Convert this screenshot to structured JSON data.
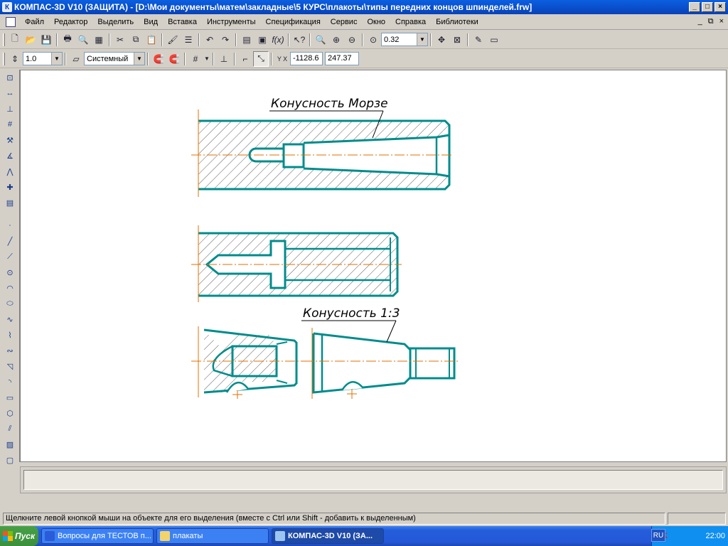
{
  "window": {
    "title": "КОМПАС-3D V10 (ЗАЩИТА) - [D:\\Мои документы\\матем\\закладные\\5 КУРС\\плакоты\\типы передних концов шпинделей.frw]",
    "app_icon": "К",
    "min_label": "_",
    "max_label": "□",
    "close_label": "×"
  },
  "menu": {
    "items": [
      "Файл",
      "Редактор",
      "Выделить",
      "Вид",
      "Вставка",
      "Инструменты",
      "Спецификация",
      "Сервис",
      "Окно",
      "Справка",
      "Библиотеки"
    ],
    "mdi_min": "_",
    "mdi_restore": "⧉",
    "mdi_close": "×"
  },
  "toolbar1": {
    "zoom_value": "0.32"
  },
  "toolbar2": {
    "step_value": "1.0",
    "style_value": "Системный",
    "coord_x": "-1128.6",
    "coord_y": "247.37"
  },
  "drawing": {
    "label_morse": "Конусность Морзе",
    "label_taper": "Конусность 1:3",
    "line_color": "#008c8c",
    "axis_color": "#e07000"
  },
  "status": {
    "message": "Щелкните левой кнопкой мыши на объекте для его выделения (вместе с Ctrl или Shift - добавить к выделенным)"
  },
  "taskbar": {
    "start_label": "Пуск",
    "tasks": [
      {
        "label": "Вопросы для ТЕСТОВ п...",
        "icon": "word-icon"
      },
      {
        "label": "плакаты",
        "icon": "folder-icon"
      },
      {
        "label": "КОМПАС-3D V10 (ЗА...",
        "icon": "kompas-icon"
      }
    ],
    "lang": "RU",
    "clock": "22:00"
  }
}
